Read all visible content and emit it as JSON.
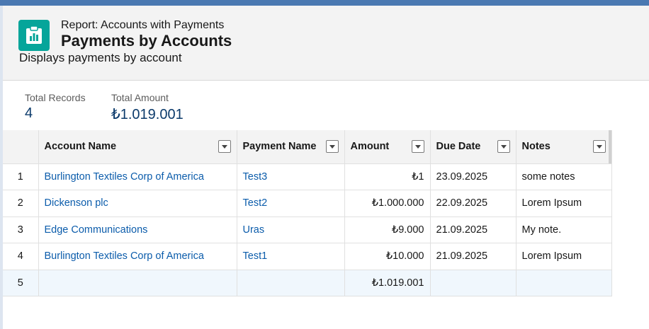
{
  "header": {
    "icon": "report-chart-icon",
    "label": "Report: Accounts with Payments",
    "title": "Payments by Accounts",
    "description": "Displays payments by account"
  },
  "summary": {
    "total_records_label": "Total Records",
    "total_records_value": "4",
    "total_amount_label": "Total Amount",
    "total_amount_value": "₺1.019.001"
  },
  "table": {
    "columns": [
      "Account Name",
      "Payment Name",
      "Amount",
      "Due Date",
      "Notes"
    ],
    "rows": [
      {
        "num": "1",
        "account": "Burlington Textiles Corp of America",
        "payment": "Test3",
        "amount": "₺1",
        "due": "23.09.2025",
        "notes": "some notes"
      },
      {
        "num": "2",
        "account": "Dickenson plc",
        "payment": "Test2",
        "amount": "₺1.000.000",
        "due": "22.09.2025",
        "notes": "Lorem Ipsum"
      },
      {
        "num": "3",
        "account": "Edge Communications",
        "payment": "Uras",
        "amount": "₺9.000",
        "due": "21.09.2025",
        "notes": "My note."
      },
      {
        "num": "4",
        "account": "Burlington Textiles Corp of America",
        "payment": "Test1",
        "amount": "₺10.000",
        "due": "21.09.2025",
        "notes": "Lorem Ipsum"
      }
    ],
    "total_row": {
      "num": "5",
      "amount": "₺1.019.001"
    }
  },
  "colors": {
    "accent": "#06a59a",
    "link": "#0b5cab",
    "summary_value": "#0b3a6b",
    "total_row_bg": "#f0f7fd"
  }
}
